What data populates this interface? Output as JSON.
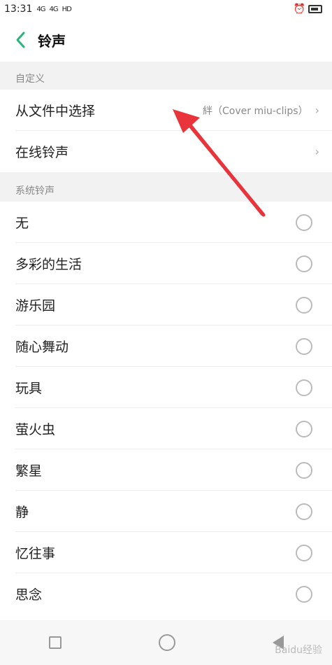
{
  "status_bar": {
    "time": "13:31",
    "signal1": "4G",
    "signal2": "4G",
    "hd": "HD"
  },
  "header": {
    "title": "铃声"
  },
  "sections": {
    "custom": "自定义",
    "system": "系统铃声"
  },
  "custom_items": [
    {
      "label": "从文件中选择",
      "value": "絆（Cover miu-clips）"
    },
    {
      "label": "在线铃声",
      "value": ""
    }
  ],
  "system_items": [
    {
      "label": "无"
    },
    {
      "label": "多彩的生活"
    },
    {
      "label": "游乐园"
    },
    {
      "label": "随心舞动"
    },
    {
      "label": "玩具"
    },
    {
      "label": "萤火虫"
    },
    {
      "label": "繁星"
    },
    {
      "label": "静"
    },
    {
      "label": "忆往事"
    },
    {
      "label": "思念"
    }
  ],
  "watermark": "Baidu经验"
}
